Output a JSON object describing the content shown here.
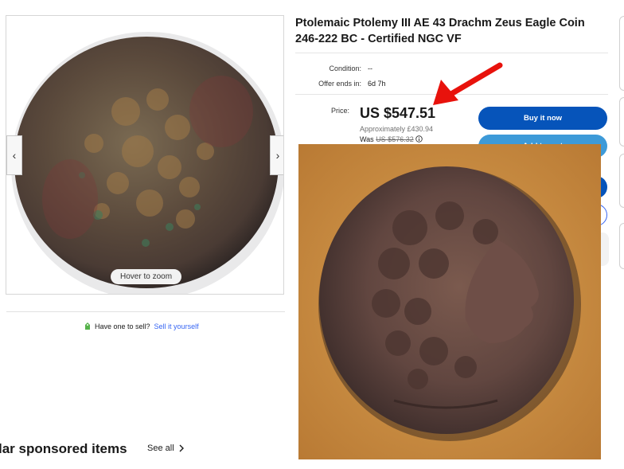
{
  "gallery": {
    "zoom_hint": "Hover to zoom"
  },
  "sell": {
    "prompt": "Have one to sell?",
    "link": "Sell it yourself"
  },
  "sponsored": {
    "heading": "lar sponsored items",
    "see_all": "See all"
  },
  "listing": {
    "title": "Ptolemaic Ptolemy III AE 43 Drachm Zeus Eagle Coin 246-222 BC - Certified NGC VF",
    "condition_label": "Condition:",
    "condition_value": "--",
    "offer_label": "Offer ends in:",
    "offer_value": "6d 7h",
    "price_label": "Price:",
    "price": "US $547.51",
    "approx": "Approximately £430.94",
    "was_label": "Was",
    "was_price": "US $576.32",
    "buy_now": "Buy it now",
    "second_button": "Add to cart"
  },
  "colors": {
    "primary_button": "#0654ba",
    "secondary_button": "#3d9ad8",
    "link": "#3665f3",
    "arrow": "#e8120c",
    "photo_background": "#c98a3a"
  },
  "icons": {
    "prev": "chevron-left-icon",
    "next": "chevron-right-icon",
    "see_all": "chevron-right-icon",
    "sell": "tag-icon",
    "info": "info-icon",
    "annotation": "red-arrow-icon"
  }
}
